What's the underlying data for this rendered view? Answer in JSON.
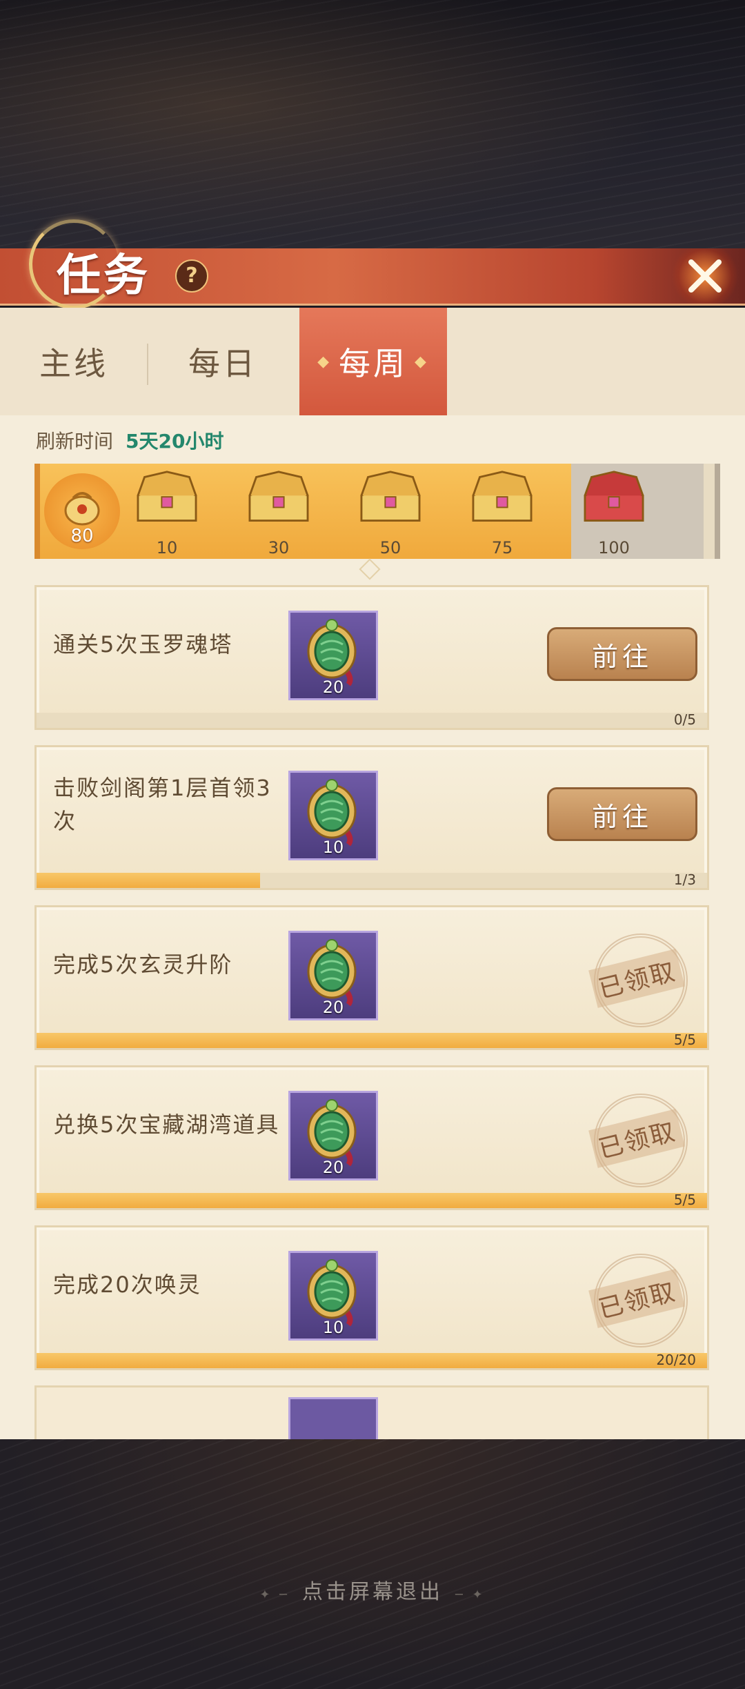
{
  "header": {
    "title": "任务",
    "help": "?",
    "close_icon": "close-icon"
  },
  "tabs": [
    {
      "label": "主线",
      "active": false
    },
    {
      "label": "每日",
      "active": false
    },
    {
      "label": "每周",
      "active": true
    }
  ],
  "refresh": {
    "label": "刷新时间",
    "value": "5天20小时"
  },
  "progress": {
    "points": "80",
    "fill_fraction": 0.8,
    "milestones": [
      {
        "label": "10",
        "claimed": true
      },
      {
        "label": "30",
        "claimed": true
      },
      {
        "label": "50",
        "claimed": true
      },
      {
        "label": "75",
        "claimed": true
      },
      {
        "label": "100",
        "claimed": false
      }
    ]
  },
  "tasks": [
    {
      "name": "通关5次玉罗魂塔",
      "reward": "20",
      "progress": "0/5",
      "fraction": 0.0,
      "status": "go",
      "button": "前往"
    },
    {
      "name": "击败剑阁第1层首领3次",
      "reward": "10",
      "progress": "1/3",
      "fraction": 0.333,
      "status": "go",
      "button": "前往"
    },
    {
      "name": "完成5次玄灵升阶",
      "reward": "20",
      "progress": "5/5",
      "fraction": 1.0,
      "status": "claimed",
      "stamp": "已领取"
    },
    {
      "name": "兑换5次宝藏湖湾道具",
      "reward": "20",
      "progress": "5/5",
      "fraction": 1.0,
      "status": "claimed",
      "stamp": "已领取"
    },
    {
      "name": "完成20次唤灵",
      "reward": "10",
      "progress": "20/20",
      "fraction": 1.0,
      "status": "claimed",
      "stamp": "已领取"
    }
  ],
  "exit_hint": "点击屏幕退出",
  "colors": {
    "accent": "#d3583d",
    "progress": "#f1ac40",
    "highlight": "#24876c"
  }
}
